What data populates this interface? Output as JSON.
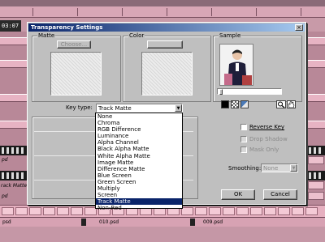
{
  "background": {
    "timecode": "03:07",
    "track_labels": [
      "pd",
      "rack Matte",
      "pd"
    ],
    "files": [
      "010.psd",
      "009.psd",
      "psd"
    ]
  },
  "dialog": {
    "title": "Transparency Settings",
    "close_label": "×",
    "matte": {
      "label": "Matte",
      "choose_label": "Choose..."
    },
    "color": {
      "label": "Color"
    },
    "sample": {
      "label": "Sample"
    },
    "key_type": {
      "label": "Key type:",
      "value": "Track Matte",
      "options": [
        "None",
        "Chroma",
        "RGB Difference",
        "Luminance",
        "Alpha Channel",
        "Black Alpha Matte",
        "White Alpha Matte",
        "Image Matte",
        "Difference Matte",
        "Blue Screen",
        "Green Screen",
        "Multiply",
        "Screen",
        "Track Matte",
        "Non-Red"
      ],
      "selected_index": 13
    },
    "reverse_key": {
      "label": "Reverse Key",
      "checked": false
    },
    "drop_shadow": {
      "label": "Drop Shadow",
      "checked": false,
      "disabled": true
    },
    "mask_only": {
      "label": "Mask Only",
      "checked": false,
      "disabled": true
    },
    "smoothing": {
      "label": "Smoothing:",
      "value": "None",
      "disabled": true
    },
    "ok_label": "OK",
    "cancel_label": "Cancel"
  }
}
